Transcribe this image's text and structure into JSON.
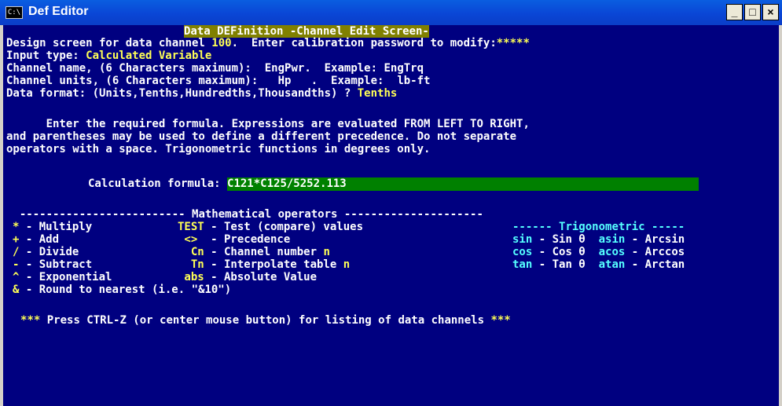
{
  "window": {
    "title": "Def Editor",
    "icon": "console-icon",
    "icon_text": "C:\\",
    "min": "_",
    "max": "□",
    "close": "×"
  },
  "header": "Data DEFinition -Channel Edit Screen-",
  "design": {
    "pre": "Design screen for data channel ",
    "channel": "100",
    "post": ".  Enter calibration password to modify:",
    "password": "*****"
  },
  "input_type": {
    "label": "Input type: ",
    "value": "Calculated Variable"
  },
  "channel_name": {
    "label": "Channel name, (6 Characters maximum):  ",
    "value": "EngPwr",
    "rest": ".  Example: EngTrq"
  },
  "channel_units": {
    "label": "Channel units, (6 Characters maximum):  ",
    "value": " Hp  ",
    "rest": " .  Example:  lb-ft"
  },
  "data_format": {
    "label": "Data format: (Units,Tenths,Hundredths,Thousandths) ? ",
    "value": "Tenths"
  },
  "instructions": [
    "      Enter the required formula. Expressions are evaluated FROM LEFT TO RIGHT,",
    "and parentheses may be used to define a different precedence. Do not separate",
    "operators with a space. Trigonometric functions in degrees only."
  ],
  "formula": {
    "label": "Calculation formula: ",
    "value": "C121*C125/5252.113"
  },
  "operators": {
    "rule_left": "  ------------------------- ",
    "title": "Mathematical operators",
    "rule_right": " ---------------------",
    "trig_rule_left": "------",
    "trig_title": "Trigonometric",
    "trig_rule_right": "-----",
    "basic": [
      {
        "sym": "*",
        "desc": " - Multiply   "
      },
      {
        "sym": "+",
        "desc": " - Add        "
      },
      {
        "sym": "/",
        "desc": " - Divide     "
      },
      {
        "sym": "-",
        "desc": " - Subtract   "
      },
      {
        "sym": "^",
        "desc": " - Exponential"
      },
      {
        "sym": "&",
        "desc": " - Round to nearest (i.e. \"&10\")"
      }
    ],
    "extended": [
      {
        "sym": "TEST",
        "desc": " - Test (compare) values",
        "arg": ""
      },
      {
        "sym": " <> ",
        "desc": " - Precedence",
        "arg": ""
      },
      {
        "sym": "  Cn",
        "desc": " - Channel number ",
        "arg": "n"
      },
      {
        "sym": "  Tn",
        "desc": " - Interpolate table ",
        "arg": "n"
      },
      {
        "sym": " abs",
        "desc": " - Absolute Value",
        "arg": ""
      }
    ],
    "trig": [
      {
        "f": "sin",
        "fd": " - Sin θ  ",
        "a": "asin",
        "ad": " - Arcsin"
      },
      {
        "f": "cos",
        "fd": " - Cos θ  ",
        "a": "acos",
        "ad": " - Arccos"
      },
      {
        "f": "tan",
        "fd": " - Tan θ  ",
        "a": "atan",
        "ad": " - Arctan"
      }
    ]
  },
  "footer": {
    "stars": "***",
    "text": " Press CTRL-Z (or center mouse button) for listing of data channels "
  },
  "colors": {
    "background": "#000080",
    "text": "#ffffff",
    "highlight": "#ffff55",
    "trig": "#55ffff",
    "header_bg": "#808000",
    "input_bg": "#008000"
  }
}
